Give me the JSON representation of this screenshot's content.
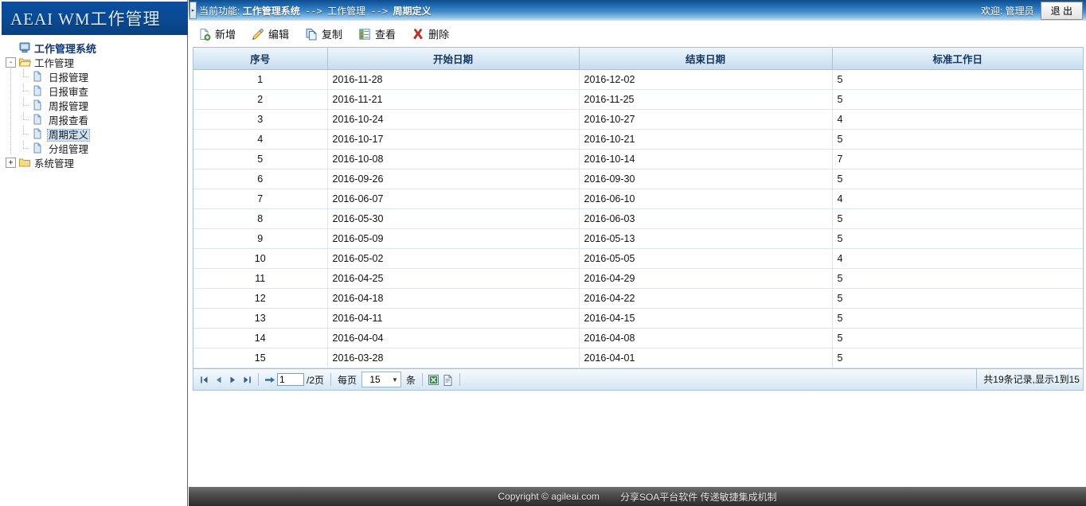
{
  "brand": {
    "title": "AEAI WM工作管理"
  },
  "sidebar": {
    "root": {
      "label": "工作管理系统",
      "icon": "computer-icon"
    },
    "nodes": [
      {
        "label": "工作管理",
        "icon": "folder-open-icon",
        "expander": "-",
        "children": [
          {
            "label": "日报管理",
            "icon": "page-icon",
            "selected": false
          },
          {
            "label": "日报审查",
            "icon": "page-icon",
            "selected": false
          },
          {
            "label": "周报管理",
            "icon": "page-icon",
            "selected": false
          },
          {
            "label": "周报查看",
            "icon": "page-icon",
            "selected": false
          },
          {
            "label": "周期定义",
            "icon": "page-icon",
            "selected": true
          },
          {
            "label": "分组管理",
            "icon": "page-icon",
            "selected": false
          }
        ]
      },
      {
        "label": "系统管理",
        "icon": "folder-closed-icon",
        "expander": "+",
        "children": []
      }
    ]
  },
  "topbar": {
    "collapse_glyph": "▸",
    "crumb_prefix": "当前功能:",
    "crumb_1": "工作管理系统",
    "crumb_sep": "-->",
    "crumb_2": "工作管理",
    "crumb_3": "周期定义",
    "welcome": "欢迎: 管理员",
    "logout_label": "退  出"
  },
  "toolbar": {
    "buttons": [
      {
        "label": "新增",
        "icon": "add-page-icon"
      },
      {
        "label": "编辑",
        "icon": "pencil-icon"
      },
      {
        "label": "复制",
        "icon": "copy-icon"
      },
      {
        "label": "查看",
        "icon": "list-view-icon"
      },
      {
        "label": "删除",
        "icon": "delete-x-icon"
      }
    ]
  },
  "grid": {
    "columns": [
      "序号",
      "开始日期",
      "结束日期",
      "标准工作日"
    ],
    "rows": [
      [
        "1",
        "2016-11-28",
        "2016-12-02",
        "5"
      ],
      [
        "2",
        "2016-11-21",
        "2016-11-25",
        "5"
      ],
      [
        "3",
        "2016-10-24",
        "2016-10-27",
        "4"
      ],
      [
        "4",
        "2016-10-17",
        "2016-10-21",
        "5"
      ],
      [
        "5",
        "2016-10-08",
        "2016-10-14",
        "7"
      ],
      [
        "6",
        "2016-09-26",
        "2016-09-30",
        "5"
      ],
      [
        "7",
        "2016-06-07",
        "2016-06-10",
        "4"
      ],
      [
        "8",
        "2016-05-30",
        "2016-06-03",
        "5"
      ],
      [
        "9",
        "2016-05-09",
        "2016-05-13",
        "5"
      ],
      [
        "10",
        "2016-05-02",
        "2016-05-05",
        "4"
      ],
      [
        "11",
        "2016-04-25",
        "2016-04-29",
        "5"
      ],
      [
        "12",
        "2016-04-18",
        "2016-04-22",
        "5"
      ],
      [
        "13",
        "2016-04-11",
        "2016-04-15",
        "5"
      ],
      [
        "14",
        "2016-04-04",
        "2016-04-08",
        "5"
      ],
      [
        "15",
        "2016-03-28",
        "2016-04-01",
        "5"
      ]
    ]
  },
  "pager": {
    "first_icon": "first-page-icon",
    "prev_icon": "prev-page-icon",
    "next_icon": "next-page-icon",
    "last_icon": "last-page-icon",
    "go_icon": "go-arrow-icon",
    "page_value": "1",
    "page_of": "/2页",
    "per_page_label": "每页",
    "per_page_value": "15",
    "per_page_unit": "条",
    "excel_icon": "excel-export-icon",
    "doc_icon": "doc-export-icon",
    "total_text": "共19条记录,显示1到15"
  },
  "footer": {
    "copyright": "Copyright © agileai.com",
    "slogan": "分享SOA平台软件  传递敏捷集成机制"
  }
}
